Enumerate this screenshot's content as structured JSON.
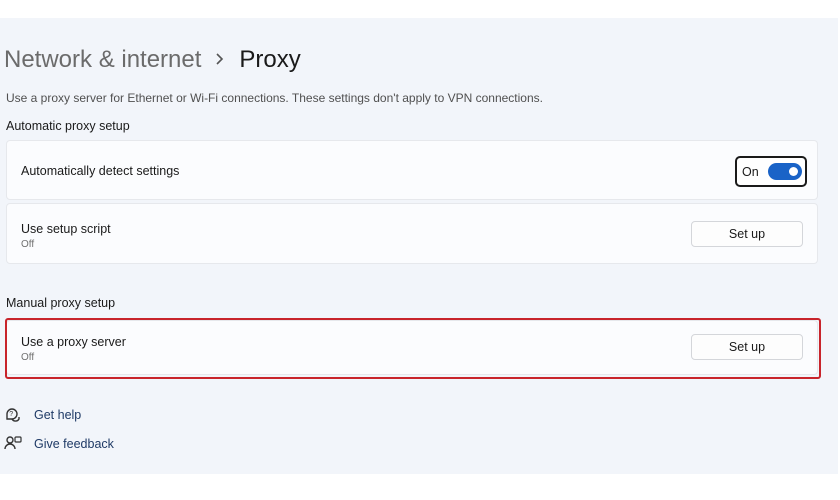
{
  "header": {
    "parent": "Network & internet",
    "separator": ">",
    "current": "Proxy"
  },
  "description": "Use a proxy server for Ethernet or Wi-Fi connections. These settings don't apply to VPN connections.",
  "automatic": {
    "section_title": "Automatic proxy setup",
    "detect": {
      "title": "Automatically detect settings",
      "toggle_state": "On",
      "toggle_on": true
    },
    "script": {
      "title": "Use setup script",
      "status": "Off",
      "button": "Set up"
    }
  },
  "manual": {
    "section_title": "Manual proxy setup",
    "proxy": {
      "title": "Use a proxy server",
      "status": "Off",
      "button": "Set up"
    }
  },
  "links": {
    "help": "Get help",
    "feedback": "Give feedback"
  },
  "colors": {
    "accent": "#1a63c7",
    "highlight": "#c8242b"
  },
  "icons": [
    "chevron-right-icon",
    "help-icon",
    "feedback-icon"
  ]
}
